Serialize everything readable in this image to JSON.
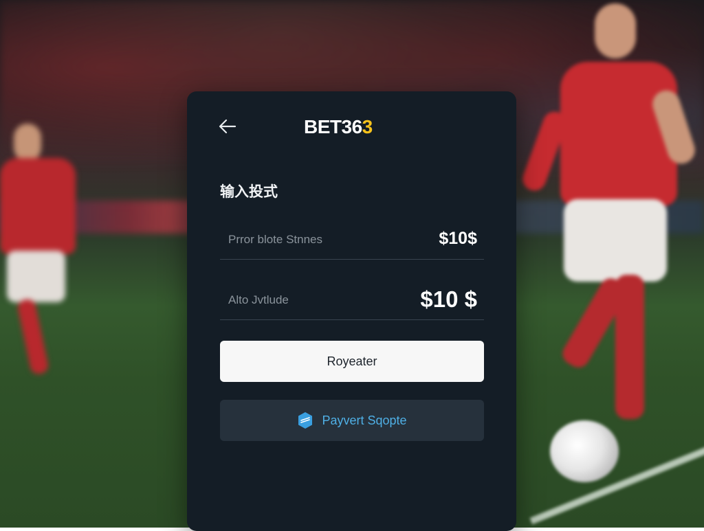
{
  "header": {
    "back_icon": "arrow-left-icon",
    "logo_main": "BET36",
    "logo_accent": "3",
    "logo_accent_color": "#f6c21c"
  },
  "form": {
    "title": "输入投式",
    "rows": [
      {
        "label": "Prror blote Stnnes",
        "value": "$10$"
      },
      {
        "label": "Alto Jvtlude",
        "value": "$10 $"
      }
    ]
  },
  "buttons": {
    "primary_label": "Royeater",
    "secondary_label": "Payvert Sqopte",
    "secondary_icon": "payment-shield-icon",
    "secondary_color": "#4fb0e6"
  }
}
